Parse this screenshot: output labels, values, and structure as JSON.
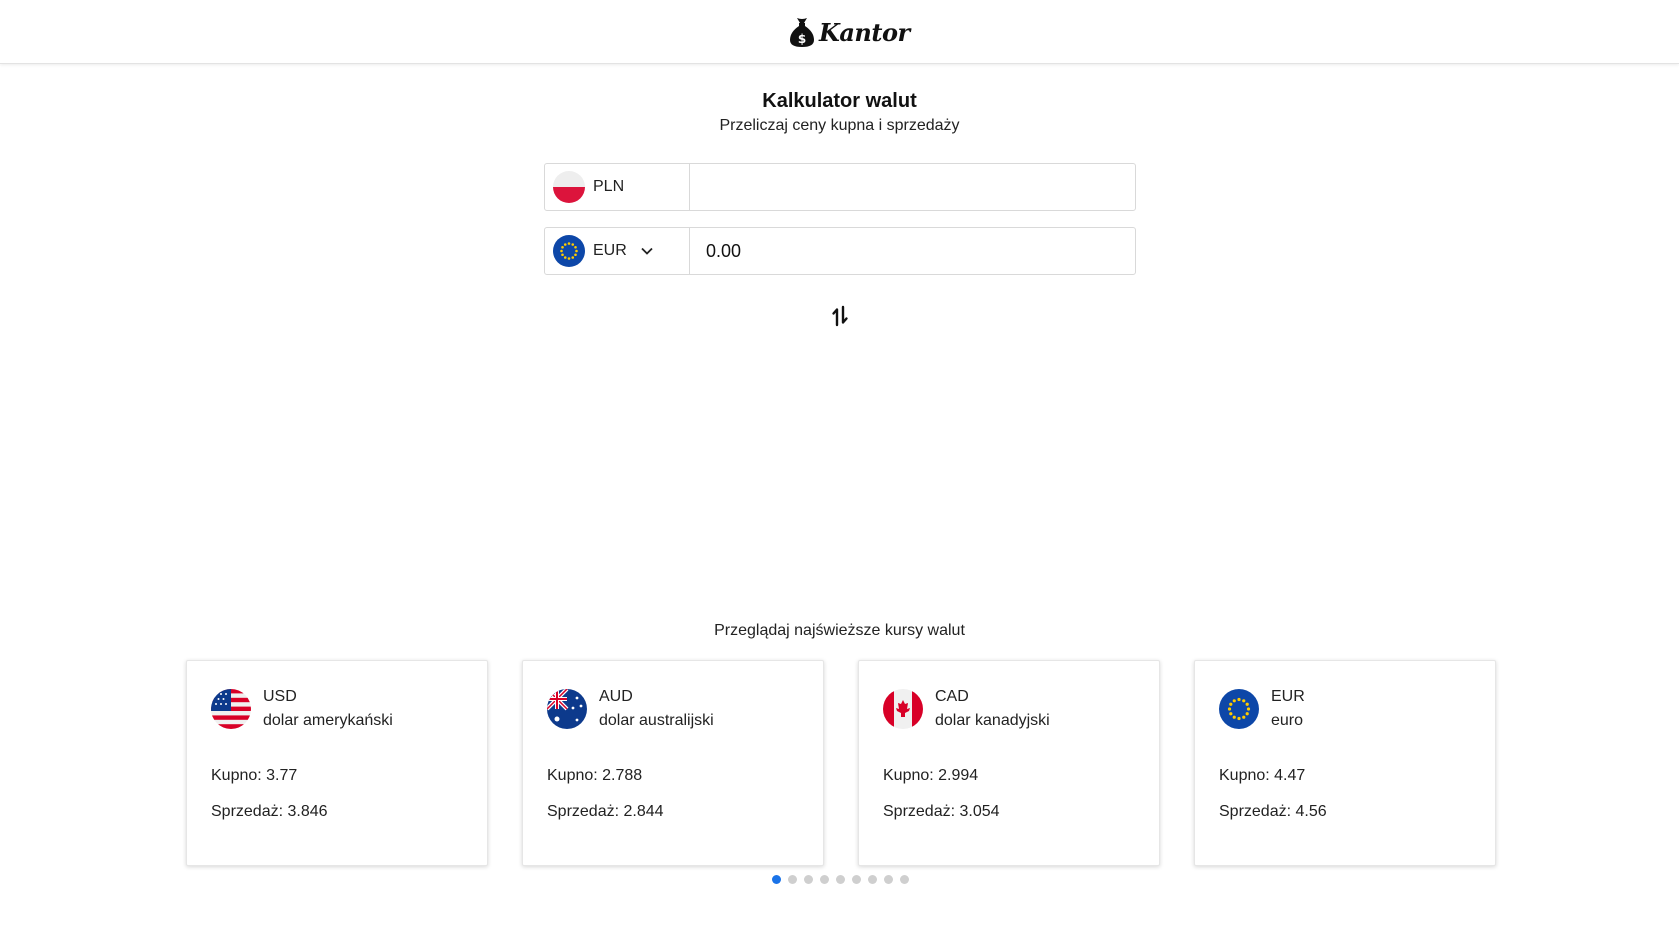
{
  "header": {
    "logo_text": "Kantor",
    "logo_icon": "money-bag-icon"
  },
  "calculator": {
    "title": "Kalkulator walut",
    "subtitle": "Przeliczaj ceny kupna i sprzedaży",
    "from": {
      "currency": "PLN",
      "flag": "poland-flag-icon",
      "value": "",
      "placeholder": ""
    },
    "to": {
      "currency": "EUR",
      "flag": "eu-flag-icon",
      "value": "0.00",
      "has_dropdown": true
    },
    "swap_icon": "swap-arrows-icon"
  },
  "rates": {
    "heading": "Przeglądaj najświeższe kursy walut",
    "cards": [
      {
        "code": "USD",
        "name": "dolar amerykański",
        "buy": "Kupno: 3.77",
        "sell": "Sprzedaż: 3.846",
        "flag": "usa-flag-icon"
      },
      {
        "code": "AUD",
        "name": "dolar australijski",
        "buy": "Kupno: 2.788",
        "sell": "Sprzedaż: 2.844",
        "flag": "australia-flag-icon"
      },
      {
        "code": "CAD",
        "name": "dolar kanadyjski",
        "buy": "Kupno: 2.994",
        "sell": "Sprzedaż: 3.054",
        "flag": "canada-flag-icon"
      },
      {
        "code": "EUR",
        "name": "euro",
        "buy": "Kupno: 4.47",
        "sell": "Sprzedaż: 4.56",
        "flag": "eu-flag-icon"
      }
    ],
    "pagination": {
      "total": 9,
      "active": 1
    }
  },
  "colors": {
    "accent": "#1a73e8",
    "eu_blue": "#0d47a8",
    "eu_gold": "#ffcc00",
    "poland_red": "#dc143c",
    "usa_red": "#d80027",
    "usa_blue": "#0d3a8c",
    "canada_red": "#d80027"
  }
}
